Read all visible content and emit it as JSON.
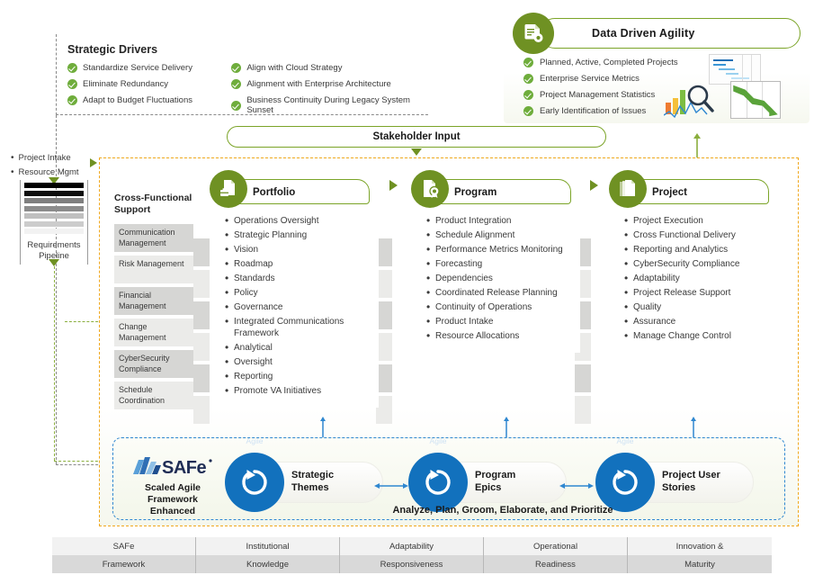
{
  "strategic_drivers": {
    "title": "Strategic Drivers",
    "left_items": [
      "Standardize Service Delivery",
      "Eliminate Redundancy",
      "Adapt to Budget Fluctuations"
    ],
    "right_items": [
      "Align with Cloud Strategy",
      "Alignment with Enterprise Architecture",
      "Business Continuity During Legacy System Sunset"
    ]
  },
  "data_driven_agility": {
    "title": "Data Driven Agility",
    "badge_icon": "document-gear-icon",
    "items": [
      "Planned, Active, Completed Projects",
      "Enterprise Service Metrics",
      "Project Management Statistics",
      "Early Identification of Issues"
    ],
    "thumbnails": [
      "gantt-chart-thumbnail",
      "bar-chart-magnifier-thumbnail",
      "declining-trend-chart-thumbnail"
    ]
  },
  "intake": {
    "items": [
      "Project Intake",
      "Resource Mgmt"
    ],
    "pipeline_label_line1": "Requirements",
    "pipeline_label_line2": "Pipeline",
    "pipeline_bars": [
      {
        "color": "#000000",
        "height": 7
      },
      {
        "color": "#0d0d0d",
        "height": 7
      },
      {
        "color": "#7f7f7f",
        "height": 6
      },
      {
        "color": "#8c8c8c",
        "height": 6
      },
      {
        "color": "#bfbfbf",
        "height": 6
      },
      {
        "color": "#cccccc",
        "height": 6
      },
      {
        "color": "#f2f2f2",
        "height": 6
      }
    ]
  },
  "stakeholder_input": {
    "label": "Stakeholder Input"
  },
  "cross_functional": {
    "title_line1": "Cross-Functional",
    "title_line2": "Support",
    "items": [
      "Communication Management",
      "Risk Management",
      "Financial Management",
      "Change Management",
      "CyberSecurity Compliance",
      "Schedule Coordination"
    ]
  },
  "columns": [
    {
      "key": "portfolio",
      "title": "Portfolio",
      "badge_icon": "document-briefcase-icon",
      "items": [
        "Operations Oversight",
        "Strategic Planning",
        "Vision",
        "Roadmap",
        "Standards",
        "Policy",
        "Governance",
        "Integrated Communications Framework",
        "Analytical",
        "Oversight",
        "Reporting",
        "Promote VA Initiatives"
      ]
    },
    {
      "key": "program",
      "title": "Program",
      "badge_icon": "document-award-icon",
      "items": [
        "Product Integration",
        "Schedule Alignment",
        "Performance Metrics Monitoring",
        "Forecasting",
        "Dependencies",
        "Coordinated Release Planning",
        "Continuity of Operations",
        "Product Intake",
        "Resource Allocations"
      ]
    },
    {
      "key": "project",
      "title": "Project",
      "badge_icon": "document-stack-icon",
      "items": [
        "Project Execution",
        "Cross Functional Delivery",
        "Reporting and Analytics",
        "CyberSecurity Compliance",
        "Adaptability",
        "Project Release Support",
        "Quality",
        "Assurance",
        "Manage Change Control"
      ]
    }
  ],
  "safe_band": {
    "logo_text": "SAFe",
    "caption_line1": "Scaled Agile",
    "caption_line2": "Framework",
    "caption_line3": "Enhanced",
    "agile_word": "Agile",
    "nodes": [
      {
        "key": "strategic-themes",
        "line1": "Strategic",
        "line2": "Themes"
      },
      {
        "key": "program-epics",
        "line1": "Program",
        "line2": "Epics"
      },
      {
        "key": "project-user-stories",
        "line1": "Project User",
        "line2": "Stories"
      }
    ],
    "footer": "Analyze, Plan, Groom, Elaborate, and Prioritize"
  },
  "footer_table": {
    "columns": [
      {
        "top": "SAFe",
        "bottom": "Framework"
      },
      {
        "top": "Institutional",
        "bottom": "Knowledge"
      },
      {
        "top": "Adaptability",
        "bottom": "Responsiveness"
      },
      {
        "top": "Operational",
        "bottom": "Readiness"
      },
      {
        "top": "Innovation &",
        "bottom": "Maturity"
      }
    ]
  },
  "colors": {
    "green": "#6f9123",
    "green_border": "#7ba428",
    "check_green": "#6fad3c",
    "orange_dash": "#f0a81e",
    "blue_dash": "#2f87d0",
    "agile_blue": "#1271bd",
    "gray_band": "#d6d6d4"
  }
}
